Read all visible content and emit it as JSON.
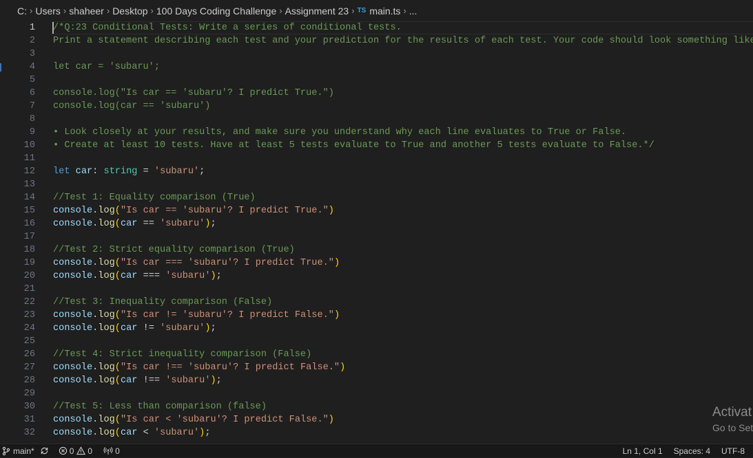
{
  "breadcrumb": {
    "segments": [
      "C:",
      "Users",
      "shaheer",
      "Desktop",
      "100 Days Coding Challenge",
      "Assignment 23"
    ],
    "file_badge": "TS",
    "file": "main.ts",
    "trailing": "..."
  },
  "editor": {
    "current_line": 1,
    "lines": [
      {
        "n": "1",
        "tokens": [
          {
            "t": "/*Q:23 Conditional Tests: Write a series of conditional tests.",
            "c": "comment"
          }
        ]
      },
      {
        "n": "2",
        "tokens": [
          {
            "t": "Print a statement describing each test and your prediction for the results of each test. Your code should look something like this:",
            "c": "comment"
          }
        ]
      },
      {
        "n": "3",
        "tokens": []
      },
      {
        "n": "4",
        "tokens": [
          {
            "t": "let car = 'subaru';",
            "c": "comment"
          }
        ]
      },
      {
        "n": "5",
        "tokens": []
      },
      {
        "n": "6",
        "tokens": [
          {
            "t": "console.log(\"Is car == 'subaru'? I predict True.\")",
            "c": "comment"
          }
        ]
      },
      {
        "n": "7",
        "tokens": [
          {
            "t": "console.log(car == 'subaru')",
            "c": "comment"
          }
        ]
      },
      {
        "n": "8",
        "tokens": []
      },
      {
        "n": "9",
        "tokens": [
          {
            "t": "• Look closely at your results, and make sure you understand why each line evaluates to True or False.",
            "c": "comment"
          }
        ]
      },
      {
        "n": "10",
        "tokens": [
          {
            "t": "• Create at least 10 tests. Have at least 5 tests evaluate to True and another 5 tests evaluate to False.*/",
            "c": "comment"
          }
        ]
      },
      {
        "n": "11",
        "tokens": []
      },
      {
        "n": "12",
        "tokens": [
          {
            "t": "let",
            "c": "kw"
          },
          {
            "t": " ",
            "c": "op"
          },
          {
            "t": "car",
            "c": "var"
          },
          {
            "t": ": ",
            "c": "op"
          },
          {
            "t": "string",
            "c": "type"
          },
          {
            "t": " = ",
            "c": "op"
          },
          {
            "t": "'subaru'",
            "c": "str"
          },
          {
            "t": ";",
            "c": "op"
          }
        ]
      },
      {
        "n": "13",
        "tokens": []
      },
      {
        "n": "14",
        "tokens": [
          {
            "t": "//Test 1: Equality comparison (True)",
            "c": "comment"
          }
        ]
      },
      {
        "n": "15",
        "tokens": [
          {
            "t": "console",
            "c": "var"
          },
          {
            "t": ".",
            "c": "op"
          },
          {
            "t": "log",
            "c": "fn"
          },
          {
            "t": "(",
            "c": "p1"
          },
          {
            "t": "\"Is car == 'subaru'? I predict True.\"",
            "c": "str"
          },
          {
            "t": ")",
            "c": "p1"
          }
        ]
      },
      {
        "n": "16",
        "tokens": [
          {
            "t": "console",
            "c": "var"
          },
          {
            "t": ".",
            "c": "op"
          },
          {
            "t": "log",
            "c": "fn"
          },
          {
            "t": "(",
            "c": "p1"
          },
          {
            "t": "car",
            "c": "var"
          },
          {
            "t": " == ",
            "c": "op"
          },
          {
            "t": "'subaru'",
            "c": "str"
          },
          {
            "t": ")",
            "c": "p1"
          },
          {
            "t": ";",
            "c": "op"
          }
        ]
      },
      {
        "n": "17",
        "tokens": []
      },
      {
        "n": "18",
        "tokens": [
          {
            "t": "//Test 2: Strict equality comparison (True)",
            "c": "comment"
          }
        ]
      },
      {
        "n": "19",
        "tokens": [
          {
            "t": "console",
            "c": "var"
          },
          {
            "t": ".",
            "c": "op"
          },
          {
            "t": "log",
            "c": "fn"
          },
          {
            "t": "(",
            "c": "p1"
          },
          {
            "t": "\"Is car === 'subaru'? I predict True.\"",
            "c": "str"
          },
          {
            "t": ")",
            "c": "p1"
          }
        ]
      },
      {
        "n": "20",
        "tokens": [
          {
            "t": "console",
            "c": "var"
          },
          {
            "t": ".",
            "c": "op"
          },
          {
            "t": "log",
            "c": "fn"
          },
          {
            "t": "(",
            "c": "p1"
          },
          {
            "t": "car",
            "c": "var"
          },
          {
            "t": " === ",
            "c": "op"
          },
          {
            "t": "'subaru'",
            "c": "str"
          },
          {
            "t": ")",
            "c": "p1"
          },
          {
            "t": ";",
            "c": "op"
          }
        ]
      },
      {
        "n": "21",
        "tokens": []
      },
      {
        "n": "22",
        "tokens": [
          {
            "t": "//Test 3: Inequality comparison (False)",
            "c": "comment"
          }
        ]
      },
      {
        "n": "23",
        "tokens": [
          {
            "t": "console",
            "c": "var"
          },
          {
            "t": ".",
            "c": "op"
          },
          {
            "t": "log",
            "c": "fn"
          },
          {
            "t": "(",
            "c": "p1"
          },
          {
            "t": "\"Is car != 'subaru'? I predict False.\"",
            "c": "str"
          },
          {
            "t": ")",
            "c": "p1"
          }
        ]
      },
      {
        "n": "24",
        "tokens": [
          {
            "t": "console",
            "c": "var"
          },
          {
            "t": ".",
            "c": "op"
          },
          {
            "t": "log",
            "c": "fn"
          },
          {
            "t": "(",
            "c": "p1"
          },
          {
            "t": "car",
            "c": "var"
          },
          {
            "t": " != ",
            "c": "op"
          },
          {
            "t": "'subaru'",
            "c": "str"
          },
          {
            "t": ")",
            "c": "p1"
          },
          {
            "t": ";",
            "c": "op"
          }
        ]
      },
      {
        "n": "25",
        "tokens": []
      },
      {
        "n": "26",
        "tokens": [
          {
            "t": "//Test 4: Strict inequality comparison (False)",
            "c": "comment"
          }
        ]
      },
      {
        "n": "27",
        "tokens": [
          {
            "t": "console",
            "c": "var"
          },
          {
            "t": ".",
            "c": "op"
          },
          {
            "t": "log",
            "c": "fn"
          },
          {
            "t": "(",
            "c": "p1"
          },
          {
            "t": "\"Is car !== 'subaru'? I predict False.\"",
            "c": "str"
          },
          {
            "t": ")",
            "c": "p1"
          }
        ]
      },
      {
        "n": "28",
        "tokens": [
          {
            "t": "console",
            "c": "var"
          },
          {
            "t": ".",
            "c": "op"
          },
          {
            "t": "log",
            "c": "fn"
          },
          {
            "t": "(",
            "c": "p1"
          },
          {
            "t": "car",
            "c": "var"
          },
          {
            "t": " !== ",
            "c": "op"
          },
          {
            "t": "'subaru'",
            "c": "str"
          },
          {
            "t": ")",
            "c": "p1"
          },
          {
            "t": ";",
            "c": "op"
          }
        ]
      },
      {
        "n": "29",
        "tokens": []
      },
      {
        "n": "30",
        "tokens": [
          {
            "t": "//Test 5: Less than comparison (false)",
            "c": "comment"
          }
        ]
      },
      {
        "n": "31",
        "tokens": [
          {
            "t": "console",
            "c": "var"
          },
          {
            "t": ".",
            "c": "op"
          },
          {
            "t": "log",
            "c": "fn"
          },
          {
            "t": "(",
            "c": "p1"
          },
          {
            "t": "\"Is car < 'subaru'? I predict False.\"",
            "c": "str"
          },
          {
            "t": ")",
            "c": "p1"
          }
        ]
      },
      {
        "n": "32",
        "tokens": [
          {
            "t": "console",
            "c": "var"
          },
          {
            "t": ".",
            "c": "op"
          },
          {
            "t": "log",
            "c": "fn"
          },
          {
            "t": "(",
            "c": "p1"
          },
          {
            "t": "car",
            "c": "var"
          },
          {
            "t": " < ",
            "c": "op"
          },
          {
            "t": "'subaru'",
            "c": "str"
          },
          {
            "t": ")",
            "c": "p1"
          },
          {
            "t": ";",
            "c": "op"
          }
        ]
      }
    ]
  },
  "watermark": {
    "line1": "Activat",
    "line2": "Go to Set"
  },
  "statusbar": {
    "branch": "main*",
    "errors": "0",
    "warnings": "0",
    "ports": "0",
    "cursor_position": "Ln 1, Col 1",
    "indent": "Spaces: 4",
    "encoding": "UTF-8"
  },
  "colors": {
    "background": "#1f1f1f",
    "comment": "#6a9955",
    "keyword": "#569cd6",
    "string": "#ce9178",
    "function": "#dcdcaa",
    "variable": "#9cdcfe",
    "type": "#4ec9b0",
    "bracket": "#ffd700"
  }
}
